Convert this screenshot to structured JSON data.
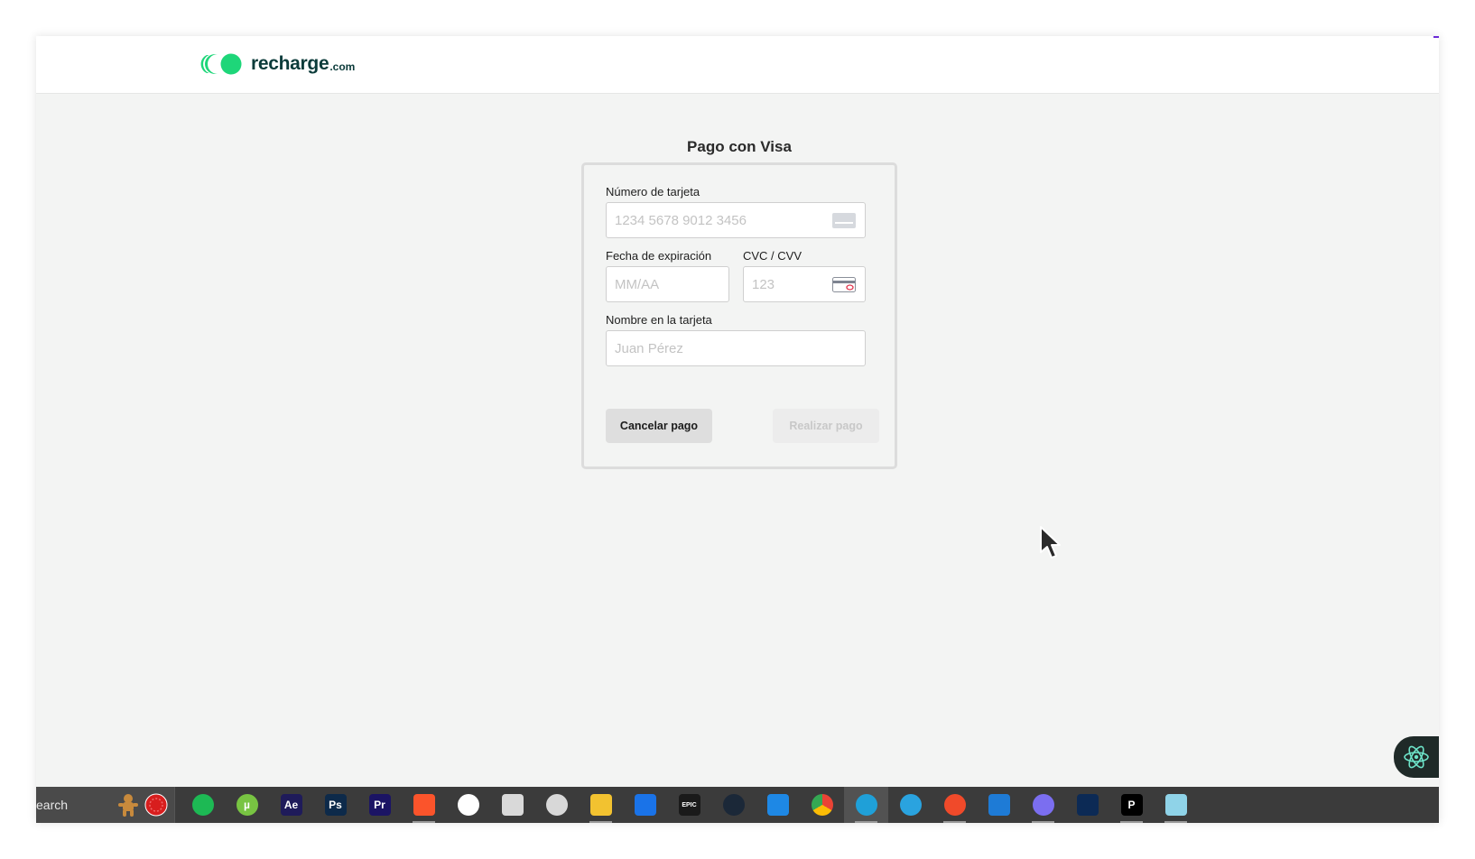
{
  "brand": {
    "name": "recharge",
    "suffix": ".com",
    "color": "#1ed679",
    "text_color": "#0b3b3a"
  },
  "payment": {
    "title": "Pago con Visa",
    "card_number": {
      "label": "Número de tarjeta",
      "placeholder": "1234 5678 9012 3456"
    },
    "expiry": {
      "label": "Fecha de expiración",
      "placeholder": "MM/AA"
    },
    "cvc": {
      "label": "CVC / CVV",
      "placeholder": "123"
    },
    "name": {
      "label": "Nombre en la tarjeta",
      "placeholder": "Juan Pérez"
    },
    "cancel_label": "Cancelar pago",
    "submit_label": "Realizar pago"
  },
  "taskbar": {
    "search_label": "earch",
    "apps": [
      {
        "name": "spotify-icon",
        "glyph": "",
        "bg": "#1db954"
      },
      {
        "name": "utorrent-icon",
        "glyph": "µ",
        "bg": "#78c442"
      },
      {
        "name": "after-effects-icon",
        "glyph": "Ae",
        "bg": "#1f1b5a"
      },
      {
        "name": "photoshop-icon",
        "glyph": "Ps",
        "bg": "#0d2a4a"
      },
      {
        "name": "premiere-icon",
        "glyph": "Pr",
        "bg": "#1b1464"
      },
      {
        "name": "brave-icon",
        "glyph": "",
        "bg": "#fb542b"
      },
      {
        "name": "moon-app-icon",
        "glyph": "",
        "bg": "#ffffff"
      },
      {
        "name": "roblox-icon",
        "glyph": "",
        "bg": "#d9d9d9"
      },
      {
        "name": "chatgpt-icon",
        "glyph": "",
        "bg": "#d8d8d8"
      },
      {
        "name": "file-explorer-icon",
        "glyph": "",
        "bg": "#f2c230"
      },
      {
        "name": "bluetooth-app-icon",
        "glyph": "",
        "bg": "#1a73e8"
      },
      {
        "name": "epic-games-icon",
        "glyph": "EPIC",
        "bg": "#1a1a1a"
      },
      {
        "name": "steam-icon",
        "glyph": "",
        "bg": "#1b2838"
      },
      {
        "name": "p-app-icon",
        "glyph": "",
        "bg": "#1e88e5"
      },
      {
        "name": "chrome-icon",
        "glyph": "",
        "bg": "#ffffff"
      },
      {
        "name": "edge-icon",
        "glyph": "",
        "bg": "#1fa0d8"
      },
      {
        "name": "telegram-icon",
        "glyph": "",
        "bg": "#2aa3df"
      },
      {
        "name": "brave-alt-icon",
        "glyph": "",
        "bg": "#f04a2a"
      },
      {
        "name": "vscode-icon",
        "glyph": "",
        "bg": "#1e7bd6"
      },
      {
        "name": "discord-icon",
        "glyph": "",
        "bg": "#7b6ef0"
      },
      {
        "name": "infinity-app-icon",
        "glyph": "",
        "bg": "#0c2a55"
      },
      {
        "name": "pycharm-icon",
        "glyph": "P",
        "bg": "#000000"
      },
      {
        "name": "notes-app-icon",
        "glyph": "",
        "bg": "#8fd3e8"
      }
    ]
  }
}
